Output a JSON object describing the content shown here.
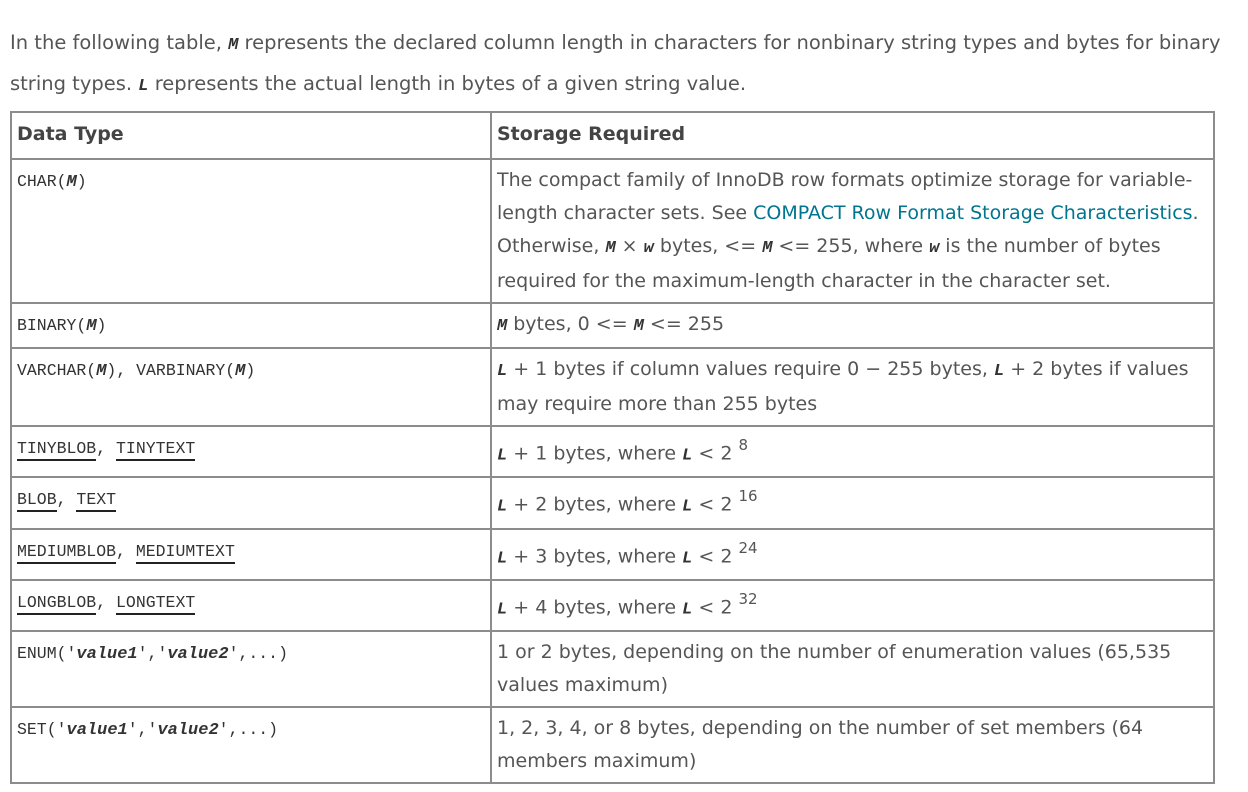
{
  "intro": {
    "t1": "In the following table, ",
    "m": "M",
    "t2": " represents the declared column length in characters for nonbinary string types and bytes for binary string types. ",
    "l": "L",
    "t3": " represents the actual length in bytes of a given string value."
  },
  "table": {
    "headers": [
      "Data Type",
      "Storage Required"
    ],
    "rows": [
      {
        "type": {
          "fn": "CHAR(",
          "arg": "M",
          "close": ")"
        },
        "storage": {
          "t1": "The compact family of InnoDB row formats optimize storage for variable-length character sets. See ",
          "link": "COMPACT Row Format Storage Characteristics",
          "t2": ". Otherwise, ",
          "m": "M",
          "times": " × ",
          "w": "w",
          "t3": " bytes, <= ",
          "m2": "M",
          "t4": " <= 255, where ",
          "w2": "w",
          "t5": " is the number of bytes required for the maximum-length character in the character set."
        }
      },
      {
        "type": {
          "fn": "BINARY(",
          "arg": "M",
          "close": ")"
        },
        "storage": {
          "m": "M",
          "t1": " bytes, 0 <= ",
          "m2": "M",
          "t2": " <= 255"
        }
      },
      {
        "type": {
          "fn1": "VARCHAR(",
          "arg1": "M",
          "mid": "), VARBINARY(",
          "arg2": "M",
          "close": ")"
        },
        "storage": {
          "l": "L",
          "t1": " + 1 bytes if column values require 0 − 255 bytes, ",
          "l2": "L",
          "t2": " + 2 bytes if values may require more than 255 bytes"
        }
      },
      {
        "type": {
          "a": "TINYBLOB",
          "sep": ", ",
          "b": "TINYTEXT"
        },
        "storage": {
          "l": "L",
          "t1": " + 1 bytes, where ",
          "l2": "L",
          "t2": " < 2 ",
          "exp": "8"
        }
      },
      {
        "type": {
          "a": "BLOB",
          "sep": ", ",
          "b": "TEXT"
        },
        "storage": {
          "l": "L",
          "t1": " + 2 bytes, where ",
          "l2": "L",
          "t2": " < 2 ",
          "exp": "16"
        }
      },
      {
        "type": {
          "a": "MEDIUMBLOB",
          "sep": ", ",
          "b": "MEDIUMTEXT"
        },
        "storage": {
          "l": "L",
          "t1": " + 3 bytes, where ",
          "l2": "L",
          "t2": " < 2 ",
          "exp": "24"
        }
      },
      {
        "type": {
          "a": "LONGBLOB",
          "sep": ", ",
          "b": "LONGTEXT"
        },
        "storage": {
          "l": "L",
          "t1": " + 4 bytes, where ",
          "l2": "L",
          "t2": " < 2 ",
          "exp": "32"
        }
      },
      {
        "type": {
          "fn": "ENUM('",
          "v1": "value1",
          "mid": "','",
          "v2": "value2",
          "close": "',...)"
        },
        "storage": {
          "text": "1 or 2 bytes, depending on the number of enumeration values (65,535 values maximum)"
        }
      },
      {
        "type": {
          "fn": "SET('",
          "v1": "value1",
          "mid": "','",
          "v2": "value2",
          "close": "',...)"
        },
        "storage": {
          "text": "1, 2, 3, 4, or 8 bytes, depending on the number of set members (64 members maximum)"
        }
      }
    ]
  }
}
